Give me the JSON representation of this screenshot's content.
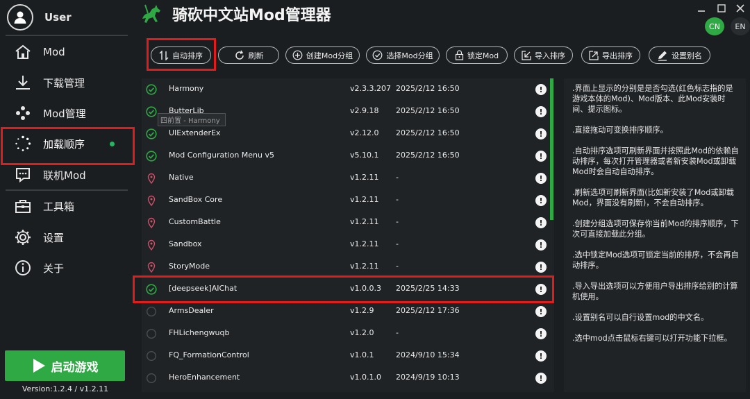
{
  "user": {
    "name": "User"
  },
  "app": {
    "title": "骑砍中文站Mod管理器",
    "version": "Version:1.2.4 / v1.2.11"
  },
  "window": {
    "lang_cn": "CN",
    "lang_en": "EN"
  },
  "sidebar": {
    "items": [
      {
        "label": "Mod",
        "icon": "home-icon"
      },
      {
        "label": "下载管理",
        "icon": "download-icon"
      },
      {
        "label": "Mod管理",
        "icon": "mod-manage-icon"
      },
      {
        "label": "加载顺序",
        "icon": "loading-icon",
        "active": true
      },
      {
        "label": "联机Mod",
        "icon": "chat-icon"
      },
      {
        "label": "工具箱",
        "icon": "toolbox-icon"
      },
      {
        "label": "设置",
        "icon": "gear-icon"
      },
      {
        "label": "关于",
        "icon": "info-icon"
      }
    ],
    "start_label": "启动游戏"
  },
  "toolbar": {
    "buttons": [
      {
        "label": "自动排序",
        "icon": "sort-icon"
      },
      {
        "label": "刷新",
        "icon": "refresh-icon"
      },
      {
        "label": "创建Mod分组",
        "icon": "plus-circle-icon"
      },
      {
        "label": "选择Mod分组",
        "icon": "check-circle-icon"
      },
      {
        "label": "锁定Mod",
        "icon": "lock-icon"
      },
      {
        "label": "导入排序",
        "icon": "import-icon"
      },
      {
        "label": "导出排序",
        "icon": "export-icon"
      },
      {
        "label": "设置别名",
        "icon": "edit-icon"
      }
    ]
  },
  "mods": [
    {
      "name": "Harmony",
      "version": "v2.3.3.207",
      "date": "2025/2/12 16:50",
      "status": "checked"
    },
    {
      "name": "ButterLib",
      "version": "v2.9.18",
      "date": "2025/2/12 16:50",
      "status": "checked"
    },
    {
      "name": "UIExtenderEx",
      "version": "v2.12.0",
      "date": "2025/2/12 16:50",
      "status": "checked"
    },
    {
      "name": "Mod Configuration Menu v5",
      "version": "v5.10.1",
      "date": "2025/2/12 16:50",
      "status": "checked"
    },
    {
      "name": "Native",
      "version": "v1.2.11",
      "date": "-",
      "status": "official"
    },
    {
      "name": "SandBox Core",
      "version": "v1.2.11",
      "date": "-",
      "status": "official"
    },
    {
      "name": "CustomBattle",
      "version": "v1.2.11",
      "date": "-",
      "status": "official"
    },
    {
      "name": "Sandbox",
      "version": "v1.2.11",
      "date": "-",
      "status": "official"
    },
    {
      "name": "StoryMode",
      "version": "v1.2.11",
      "date": "-",
      "status": "official"
    },
    {
      "name": "[deepseek]AIChat",
      "version": "v1.0.0.3",
      "date": "2025/2/25 14:33",
      "status": "checked"
    },
    {
      "name": "ArmsDealer",
      "version": "v1.2.9",
      "date": "2025/2/12 17:36",
      "status": "unchecked"
    },
    {
      "name": "FHLichengwuqb",
      "version": "v1.2.0",
      "date": "-",
      "status": "unchecked"
    },
    {
      "name": "FQ_FormationControl",
      "version": "v1.0.1",
      "date": "2024/9/10 15:34",
      "status": "unchecked"
    },
    {
      "name": "HeroEnhancement",
      "version": "v1.0.1.0",
      "date": "2024/9/19 10:13",
      "status": "unchecked"
    }
  ],
  "tooltip": "四前置 - Harmony",
  "help": [
    ".界面上显示的分别是是否勾选(红色标志指的是游戏本体的Mod)、Mod版本、此Mod安装时间、提示图标。",
    ".直接拖动可变换排序顺序。",
    ".自动排序选项可刷新界面并按照此Mod的依赖自动排序，每次打开管理器或者新安装Mod或卸载Mod时会自动自动排序。",
    ".刷新选项可刷新界面(比如新安装了Mod或卸载Mod，界面没有刷新)，不会自动排序。",
    ".创建分组选项可保存你当前Mod的排序顺序，下次可直接加载此分组。",
    ".选中锁定Mod选项可锁定当前的排序，不会再自动排序。",
    ".导入导出选项可以方便用户导出排序给别的计算机使用。",
    ".设置别名可以自行设置mod的中文名。",
    ".选中mod点击鼠标右键可以打开功能下拉框。"
  ],
  "colors": {
    "accent": "#2ea943",
    "highlight_box": "#e41b1b",
    "official_marker": "#d0506a"
  }
}
